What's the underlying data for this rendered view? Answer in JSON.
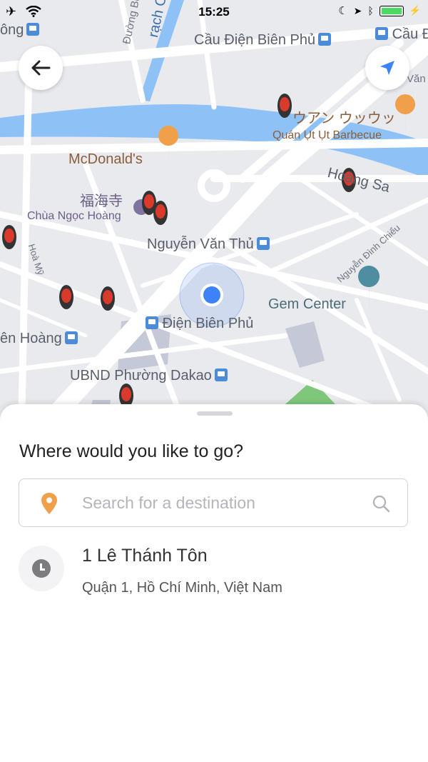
{
  "status_bar": {
    "time": "15:25"
  },
  "map": {
    "labels": {
      "cau_dien_bien_phu_1": "Cầu Điện Biên Phủ",
      "cau_dien_bien_phu_2": "Cầu Đ",
      "ong_partial": "ông",
      "duong_bui": "Đường Bùi",
      "rach_ca": "rạch Cầ",
      "van_partial": "Văn",
      "japanese_shop": "ウアン ウッウッ",
      "quan_ut_ut": "Quán Ụt Ụt Barbecue",
      "mcdonalds": "McDonald's",
      "hoang_sa": "Hoàng Sa",
      "chinese_temple": "福海寺",
      "chua_ngoc_hoang": "Chùa Ngọc Hoàng",
      "nguyen_van_thu": "Nguyễn Văn Thủ",
      "nguyen_dinh_chieu": "Nguyễn Đình Chiểu",
      "hoa_my": "Hoà Mỹ",
      "gem_center": "Gem Center",
      "dien_bien_phu": "Điện Biên Phủ",
      "en_hoang": "ên Hoàng",
      "ubnd_dakao": "UBND Phường Dakao"
    }
  },
  "buttons": {
    "back": "back",
    "locate": "locate"
  },
  "sheet": {
    "heading": "Where would you like to go?",
    "search_placeholder": "Search for a destination",
    "search_value": "",
    "recent": [
      {
        "title": "1 Lê Thánh Tôn",
        "subtitle": "Quận 1, Hồ Chí Minh, Việt Nam"
      }
    ]
  },
  "colors": {
    "water": "#8ec2f7",
    "road": "#ffffff",
    "map_bg": "#e9eaee",
    "accent_blue": "#3e82f7",
    "pin_orange": "#f0a04b",
    "park_green": "#7ec77b"
  }
}
